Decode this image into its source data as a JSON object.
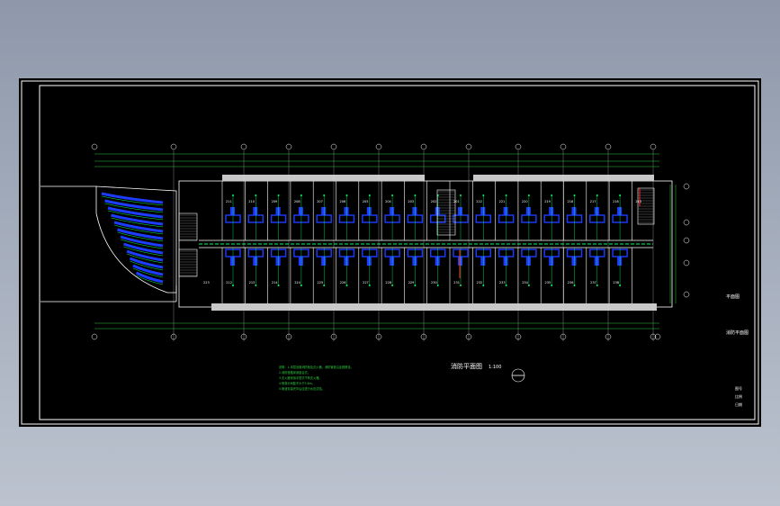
{
  "drawing": {
    "title": "消防平面图",
    "scale": "1:100",
    "room_numbers_top": [
      "211",
      "210",
      "209",
      "208",
      "207",
      "206",
      "205",
      "204",
      "203",
      "202",
      "201",
      "222",
      "221",
      "220",
      "219",
      "218",
      "217",
      "216",
      "215"
    ],
    "room_numbers_bottom": [
      "223",
      "212",
      "213",
      "214",
      "224",
      "225",
      "226",
      "227",
      "228",
      "229",
      "230",
      "231",
      "232",
      "233",
      "234",
      "235",
      "236",
      "237",
      "238"
    ],
    "title_block": {
      "drawing_name": "消防平面图",
      "side_label": "平面图",
      "small_labels": [
        "图号",
        "比例",
        "日期"
      ]
    },
    "notes": [
      "说明：1.本层设置消防栓及灭火器，消防管道沿走廊敷设。",
      "2.消防栓箱采用组合式。",
      "3.灭火器采用手提式干粉灭火器。",
      "4.喷淋头间距不大于3.6m。",
      "5.管道安装完毕后应进行水压试验。"
    ],
    "colors": {
      "frame": "#ffffff",
      "wall": "#c8c8c8",
      "grid": "#dcdcdc",
      "dims": "#2ecc40",
      "pipes": "#00ff66",
      "fixtures": "#1e3cff",
      "accent": "#ff2a2a"
    }
  }
}
